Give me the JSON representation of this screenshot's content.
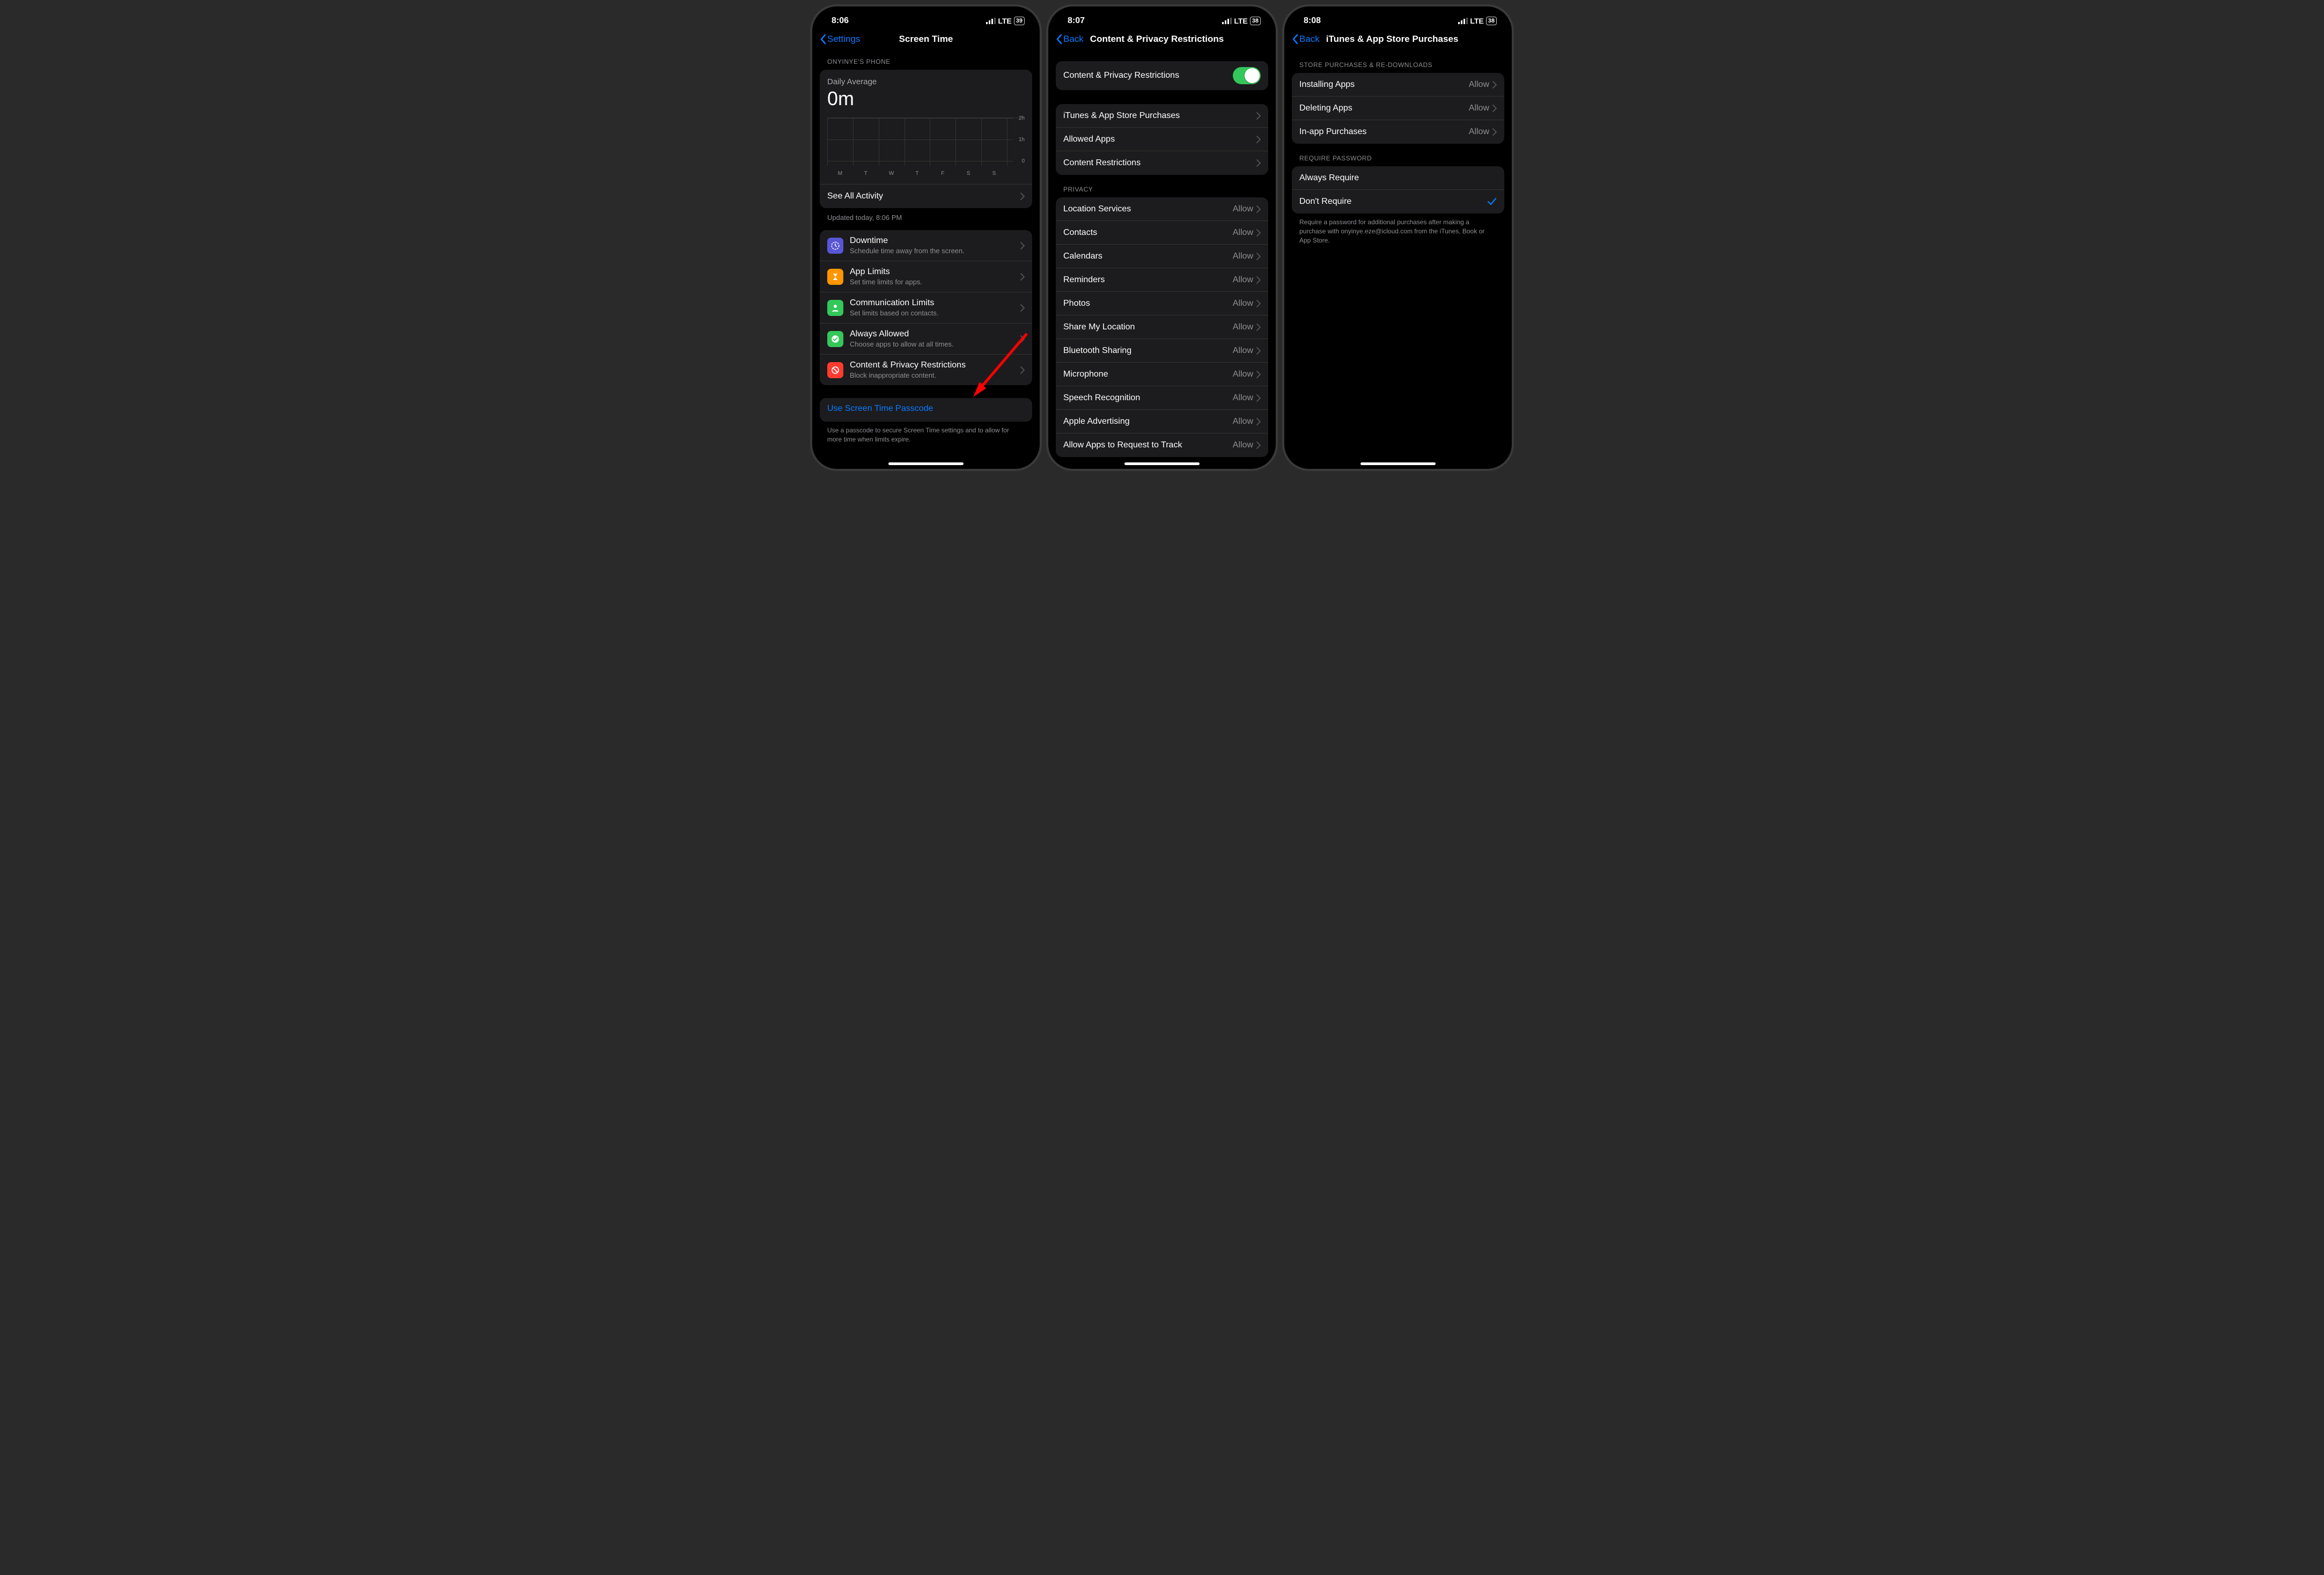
{
  "phones": [
    {
      "status": {
        "time": "8:06",
        "network": "LTE",
        "battery": "39"
      },
      "nav": {
        "back": "Settings",
        "title": "Screen Time",
        "centered": true
      },
      "section_header": "ONYINYE'S PHONE",
      "summary": {
        "daily_avg_label": "Daily Average",
        "daily_avg_value": "0m",
        "yticks": [
          "2h",
          "1h",
          "0"
        ],
        "days": [
          "M",
          "T",
          "W",
          "T",
          "F",
          "S",
          "S"
        ],
        "see_all": "See All Activity"
      },
      "updated": "Updated today, 8:06 PM",
      "items": [
        {
          "icon_color": "#5856d6",
          "icon": "clock",
          "title": "Downtime",
          "subtitle": "Schedule time away from the screen."
        },
        {
          "icon_color": "#ff9500",
          "icon": "hourglass",
          "title": "App Limits",
          "subtitle": "Set time limits for apps."
        },
        {
          "icon_color": "#34c759",
          "icon": "person",
          "title": "Communication Limits",
          "subtitle": "Set limits based on contacts."
        },
        {
          "icon_color": "#34c759",
          "icon": "check",
          "title": "Always Allowed",
          "subtitle": "Choose apps to allow at all times."
        },
        {
          "icon_color": "#ff3b30",
          "icon": "nosign",
          "title": "Content & Privacy Restrictions",
          "subtitle": "Block inappropriate content."
        }
      ],
      "passcode": {
        "link": "Use Screen Time Passcode",
        "footer": "Use a passcode to secure Screen Time settings and to allow for more time when limits expire."
      }
    },
    {
      "status": {
        "time": "8:07",
        "network": "LTE",
        "battery": "38"
      },
      "nav": {
        "back": "Back",
        "title": "Content & Privacy Restrictions",
        "centered": false
      },
      "toggle_row": {
        "label": "Content & Privacy Restrictions",
        "on": true
      },
      "group1": [
        {
          "label": "iTunes & App Store Purchases"
        },
        {
          "label": "Allowed Apps"
        },
        {
          "label": "Content Restrictions"
        }
      ],
      "privacy_header": "PRIVACY",
      "privacy": [
        {
          "label": "Location Services",
          "value": "Allow"
        },
        {
          "label": "Contacts",
          "value": "Allow"
        },
        {
          "label": "Calendars",
          "value": "Allow"
        },
        {
          "label": "Reminders",
          "value": "Allow"
        },
        {
          "label": "Photos",
          "value": "Allow"
        },
        {
          "label": "Share My Location",
          "value": "Allow"
        },
        {
          "label": "Bluetooth Sharing",
          "value": "Allow"
        },
        {
          "label": "Microphone",
          "value": "Allow"
        },
        {
          "label": "Speech Recognition",
          "value": "Allow"
        },
        {
          "label": "Apple Advertising",
          "value": "Allow"
        },
        {
          "label": "Allow Apps to Request to Track",
          "value": "Allow"
        }
      ]
    },
    {
      "status": {
        "time": "8:08",
        "network": "LTE",
        "battery": "38"
      },
      "nav": {
        "back": "Back",
        "title": "iTunes & App Store Purchases",
        "centered": false
      },
      "store_header": "STORE PURCHASES & RE-DOWNLOADS",
      "store": [
        {
          "label": "Installing Apps",
          "value": "Allow"
        },
        {
          "label": "Deleting Apps",
          "value": "Allow"
        },
        {
          "label": "In-app Purchases",
          "value": "Allow"
        }
      ],
      "password_header": "REQUIRE PASSWORD",
      "password_options": [
        {
          "label": "Always Require",
          "checked": false
        },
        {
          "label": "Don't Require",
          "checked": true
        }
      ],
      "password_footer": "Require a password for additional purchases after making a purchase with onyinye.eze@icloud.com from the iTunes, Book or App Store."
    }
  ]
}
